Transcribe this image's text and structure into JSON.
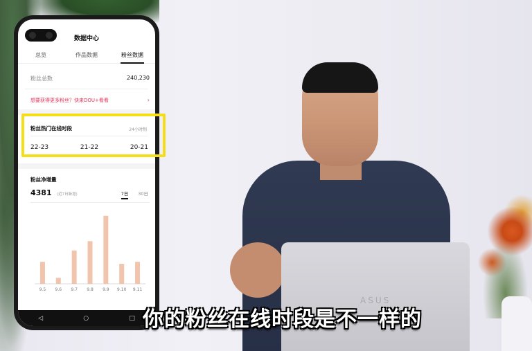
{
  "phone": {
    "title": "数据中心",
    "tabs": [
      {
        "label": "总览"
      },
      {
        "label": "作品数据"
      },
      {
        "label": "粉丝数据",
        "active": true
      }
    ],
    "total_label": "粉丝总数",
    "total_value": "240,230",
    "promo_text": "想要获得更多粉丝？快来DOU+看看",
    "promo_arrow": "›",
    "hot_section": {
      "title": "粉丝热门在线时段",
      "badge": "24小时制",
      "slots": [
        "22-23",
        "21-22",
        "20-21"
      ]
    },
    "growth": {
      "title": "粉丝净增量",
      "value": "4381",
      "note": "(近7日新增)",
      "range_tabs": [
        {
          "label": "7日",
          "active": true
        },
        {
          "label": "30日"
        }
      ]
    },
    "nav_icons": [
      "back-icon",
      "home-icon",
      "recents-icon"
    ]
  },
  "chart_data": {
    "type": "bar",
    "categories": [
      "9.5",
      "9.6",
      "9.7",
      "9.8",
      "9.9",
      "9.10",
      "9.11"
    ],
    "values": [
      330,
      90,
      500,
      640,
      1020,
      300,
      330
    ],
    "ylim": [
      0,
      1100
    ],
    "bar_color": "#f1c4ad"
  },
  "subtitle": "你的粉丝在线时段是不一样的",
  "colors": {
    "highlight": "#f4dd1a",
    "promo": "#e2335a"
  }
}
